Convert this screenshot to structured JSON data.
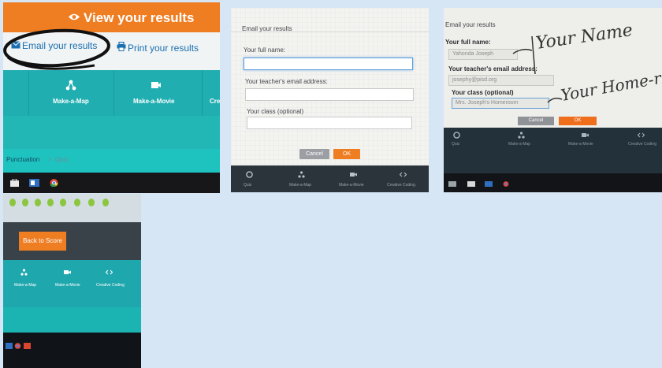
{
  "photo1": {
    "view_results": "View your results",
    "email_results": "Email your results",
    "print_results": "Print your results",
    "tiles": [
      "Make-a-Map",
      "Make-a-Movie",
      "Cre"
    ],
    "breadcrumb": "Punctuation",
    "breadcrumb_sep": ">",
    "breadcrumb_current": "Quiz"
  },
  "photo2": {
    "dialog_title": "Email your results",
    "full_name_label": "Your full name:",
    "teacher_email_label": "Your teacher's email address:",
    "class_label": "Your class (optional)",
    "cancel": "Cancel",
    "ok": "OK",
    "tiles": [
      "Quiz",
      "Make-a-Map",
      "Make-a-Movie",
      "Creative Coding"
    ]
  },
  "photo3": {
    "dialog_title": "Email your results",
    "full_name_label": "Your full name:",
    "full_name_value": "Yahonda Joseph",
    "teacher_email_label": "Your teacher's email address:",
    "teacher_email_value": "josephy@pisd.org",
    "class_label": "Your class (optional)",
    "class_value": "Mrs. Joseph's Homeroom",
    "cancel": "Cancel",
    "ok": "OK",
    "annotation_1": "Your Name",
    "annotation_2": "Your Home-room",
    "tiles": [
      "Quiz",
      "Make-a-Map",
      "Make-a-Movie",
      "Creative Coding"
    ]
  },
  "photo4": {
    "back_to_score": "Back to Score",
    "tiles": [
      "Make-a-Map",
      "Make-a-Movie",
      "Creative Coding"
    ]
  },
  "colors": {
    "orange": "#ef7d22",
    "teal": "#20aeb1",
    "link_blue": "#1a6fb0",
    "background": "#d6e6f4"
  }
}
